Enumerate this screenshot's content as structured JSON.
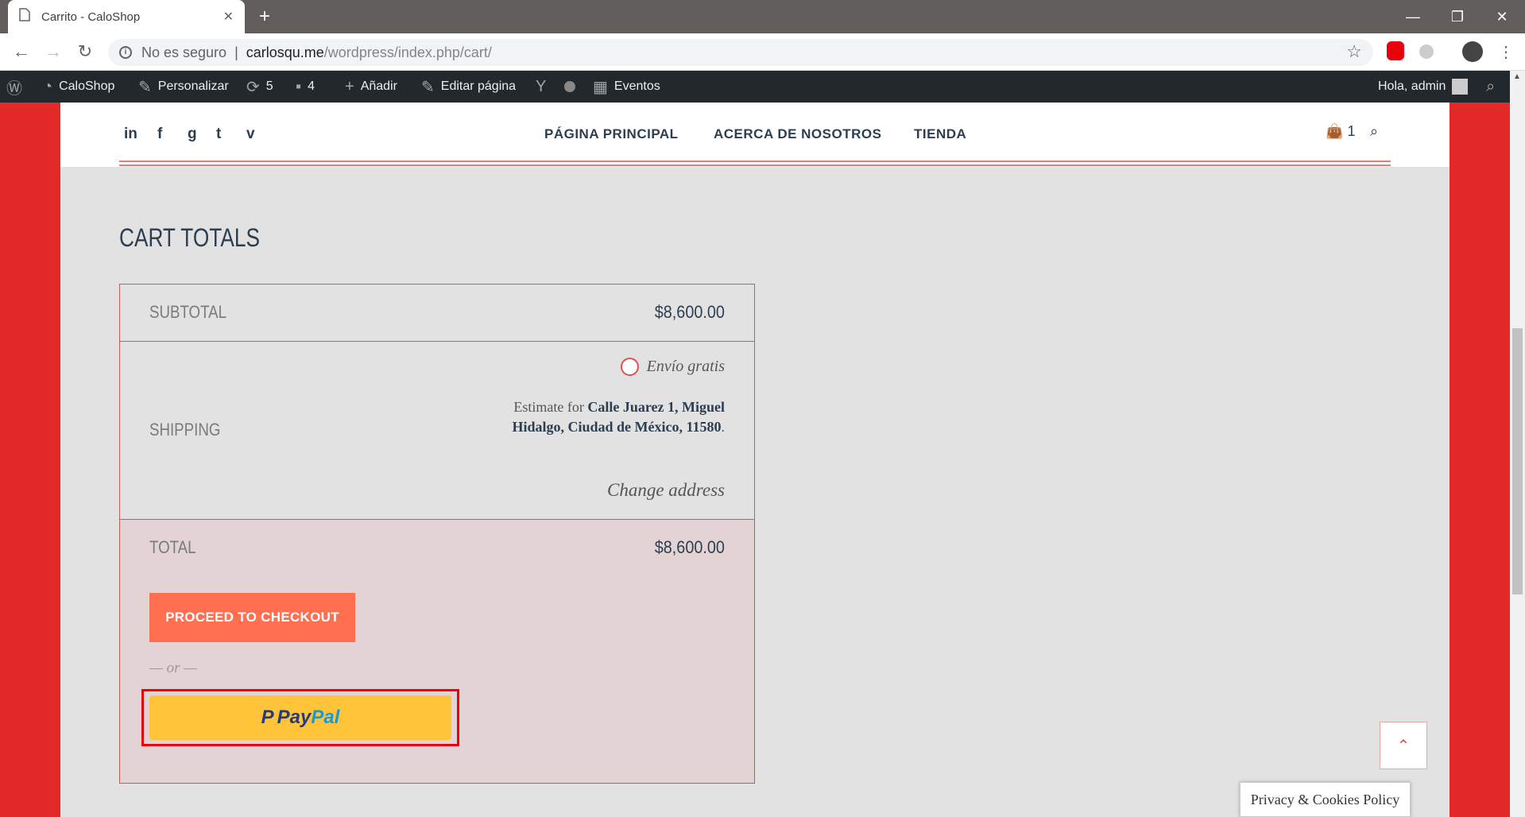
{
  "browser": {
    "tab_title": "Carrito - CaloShop",
    "close_glyph": "✕",
    "new_tab_glyph": "+",
    "not_secure": "No es seguro",
    "url_host": "carlosqu.me",
    "url_path": "/wordpress/index.php/cart/"
  },
  "admin_bar": {
    "site_name": "CaloShop",
    "customize": "Personalizar",
    "updates_count": "5",
    "comments_count": "4",
    "add_new": "Añadir",
    "edit_page": "Editar página",
    "events": "Eventos",
    "greeting": "Hola, admin"
  },
  "site_header": {
    "social": [
      "in",
      "f",
      "g",
      "t",
      "v"
    ],
    "menu": [
      "PÁGINA PRINCIPAL",
      "ACERCA DE NOSOTROS",
      "TIENDA"
    ],
    "cart_count": "1"
  },
  "cart_totals": {
    "title": "CART TOTALS",
    "subtotal_label": "SUBTOTAL",
    "subtotal_value": "$8,600.00",
    "shipping_label": "SHIPPING",
    "shipping_option": "Envío gratis",
    "estimate_prefix": "Estimate for",
    "estimate_address": "Calle Juarez 1, Miguel Hidalgo, Ciudad de México, 11580",
    "estimate_suffix": ".",
    "change_address": "Change address",
    "total_label": "TOTAL",
    "total_value": "$8,600.00",
    "checkout_button": "PROCEED TO CHECKOUT",
    "or_text": "— or —",
    "paypal_pay": "Pay",
    "paypal_pal": "Pal"
  },
  "footer": {
    "privacy": "Privacy & Cookies Policy"
  },
  "colors": {
    "brand_red": "#e42a28",
    "checkout_orange": "#ff6f50",
    "paypal_yellow": "#ffc439",
    "highlight_border": "#e8000b"
  }
}
